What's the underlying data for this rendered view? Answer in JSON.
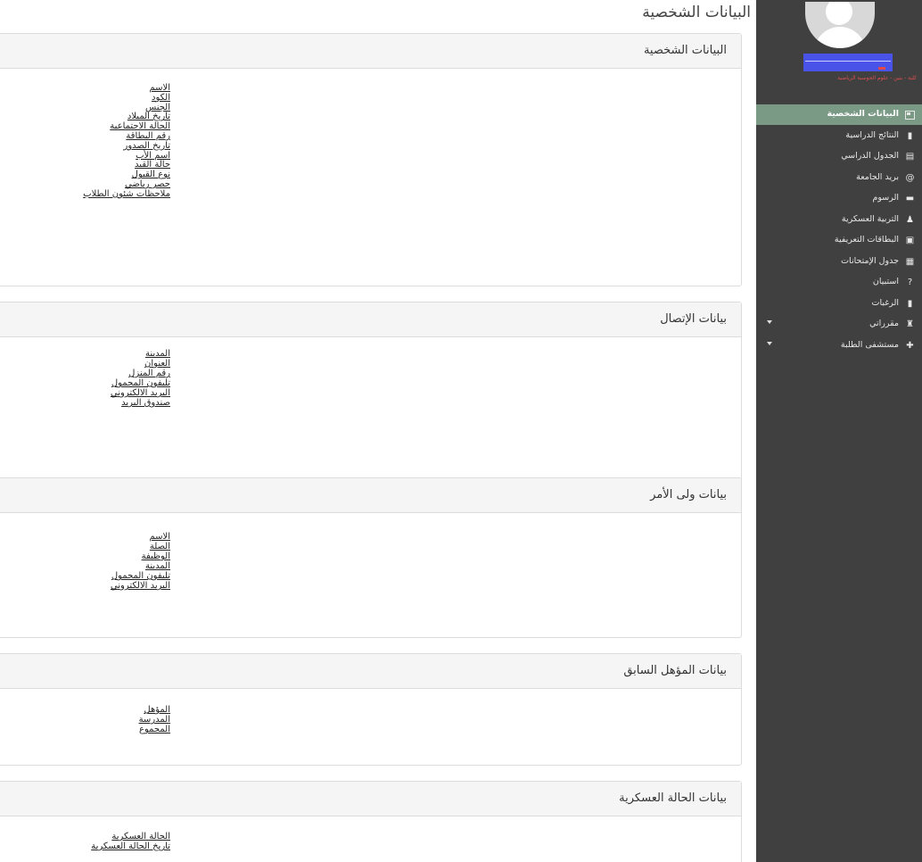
{
  "page_title": "البيانات الشخصية",
  "sections": [
    {
      "title": "البيانات الشخصية",
      "fields": [
        "الاسم",
        "الكود",
        "الجنس",
        "تاريخ الميلاد",
        "الحالة الاجتماعية",
        "رقم البطاقة",
        "تاريخ الصدور",
        "اسم الأب",
        "حالة القيد",
        "نوع القبول",
        "حصر رياضي",
        "ملاحظات شئون الطلاب"
      ]
    },
    {
      "title": "بيانات الإتصال",
      "fields": [
        "المدينة",
        "العنوان",
        "رقم المنزل",
        "تليفون المحمول",
        "البريد الالكتروني",
        "صندوق البريد"
      ]
    },
    {
      "title": "بيانات ولى الأمر",
      "fields": [
        "الاسم",
        "الصلة",
        "الوظيفة",
        "المدينة",
        "تليفون المحمول",
        "البريد الالكتروني"
      ]
    },
    {
      "title": "بيانات المؤهل السابق",
      "fields": [
        "المؤهل",
        "المدرسة",
        "المجموع"
      ]
    },
    {
      "title": "بيانات الحالة العسكرية",
      "fields": [
        "الحالة العسكرية",
        "تاريخ الحالة العسكرية"
      ]
    }
  ],
  "sidebar": {
    "faculty": "كلية - بنين - علوم الحوسبة الرياضية",
    "items": [
      {
        "label": "البيانات الشخصية",
        "icon": "id-card-icon",
        "glyph": "",
        "active": true,
        "caret": false
      },
      {
        "label": "النتائج الدراسية",
        "icon": "bar-chart-icon",
        "glyph": "▮",
        "active": false,
        "caret": false
      },
      {
        "label": "الجدول الدراسي",
        "icon": "calendar-icon",
        "glyph": "▤",
        "active": false,
        "caret": false
      },
      {
        "label": "بريد الجامعة",
        "icon": "at-icon",
        "glyph": "@",
        "active": false,
        "caret": false
      },
      {
        "label": "الرسوم",
        "icon": "money-icon",
        "glyph": "▬",
        "active": false,
        "caret": false
      },
      {
        "label": "التربية العسكرية",
        "icon": "users-icon",
        "glyph": "♟",
        "active": false,
        "caret": false
      },
      {
        "label": "البطاقات التعريفية",
        "icon": "vcard-icon",
        "glyph": "▣",
        "active": false,
        "caret": false
      },
      {
        "label": "جدول الإمتحانات",
        "icon": "calendar-exam-icon",
        "glyph": "▦",
        "active": false,
        "caret": false
      },
      {
        "label": "استبيان",
        "icon": "question-circle-icon",
        "glyph": "?",
        "active": false,
        "caret": false
      },
      {
        "label": "الرغبات",
        "icon": "clipboard-icon",
        "glyph": "▮",
        "active": false,
        "caret": false
      },
      {
        "label": "مقرراتي",
        "icon": "books-icon",
        "glyph": "♜",
        "active": false,
        "caret": true
      },
      {
        "label": "مستشفى الطلبة",
        "icon": "hospital-icon",
        "glyph": "✚",
        "active": false,
        "caret": true
      }
    ]
  }
}
